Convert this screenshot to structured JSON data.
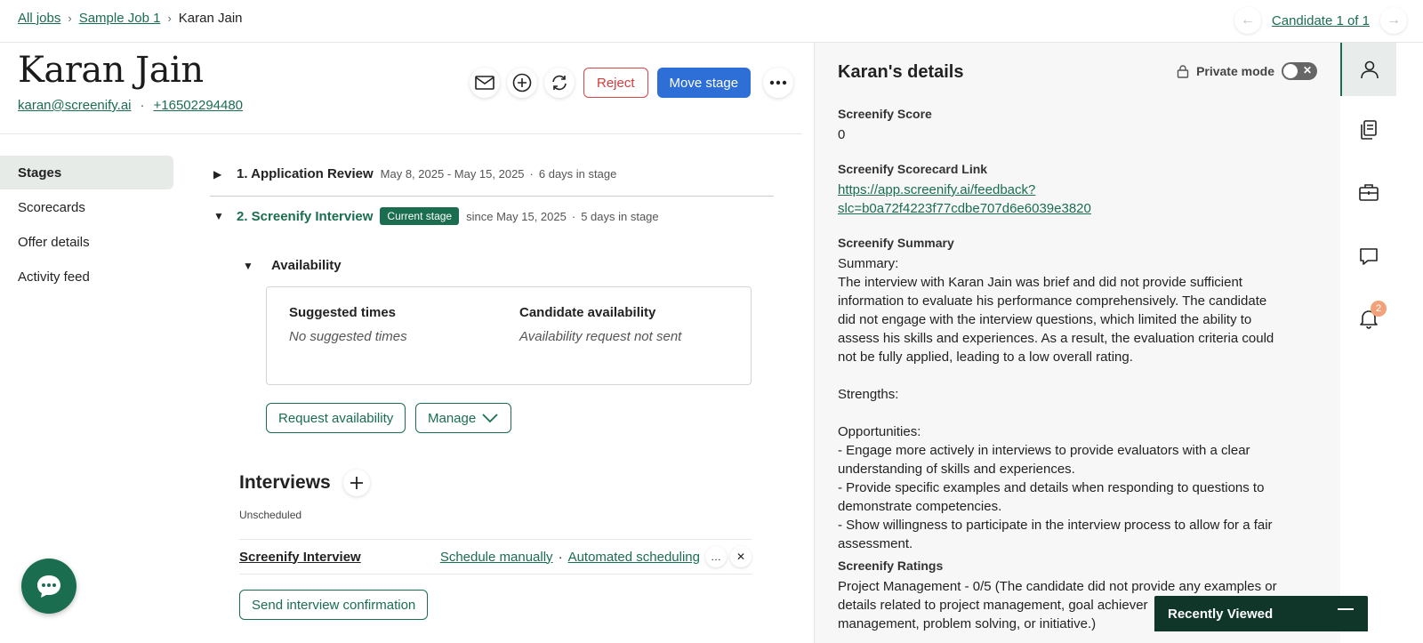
{
  "breadcrumb": {
    "all_jobs": "All jobs",
    "job": "Sample Job 1",
    "current": "Karan Jain"
  },
  "candidate_nav": {
    "label": "Candidate 1 of 1"
  },
  "candidate": {
    "name": "Karan Jain",
    "email": "karan@screenify.ai",
    "phone": "+16502294480"
  },
  "actions": {
    "reject": "Reject",
    "move_stage": "Move stage"
  },
  "nav": {
    "items": [
      "Stages",
      "Scorecards",
      "Offer details",
      "Activity feed"
    ],
    "active": "Stages"
  },
  "stages": [
    {
      "title": "1. Application Review",
      "dates": "May 8, 2025 - May 15, 2025",
      "days": "6 days in stage"
    },
    {
      "title": "2. Screenify Interview",
      "badge": "Current stage",
      "dates": "since May 15, 2025",
      "days": "5 days in stage"
    }
  ],
  "availability": {
    "title": "Availability",
    "suggested_label": "Suggested times",
    "suggested_value": "No suggested times",
    "candidate_label": "Candidate availability",
    "candidate_value": "Availability request not sent",
    "request_btn": "Request availability",
    "manage_btn": "Manage"
  },
  "interviews": {
    "title": "Interviews",
    "unscheduled": "Unscheduled",
    "row_name": "Screenify Interview",
    "schedule_manually": "Schedule manually",
    "automated": "Automated scheduling",
    "send_confirmation": "Send interview confirmation"
  },
  "details": {
    "title": "Karan's details",
    "private_mode": "Private mode",
    "score_label": "Screenify Score",
    "score_value": "0",
    "scorecard_label": "Screenify Scorecard Link",
    "scorecard_link_line1": "https://app.screenify.ai/feedback?",
    "scorecard_link_line2": "slc=b0a72f4223f77cdbe707d6e6039e3820",
    "summary_label": "Screenify Summary",
    "summary_text": "Summary:\nThe interview with Karan Jain was brief and did not provide sufficient\ninformation to evaluate his performance comprehensively. The candidate\ndid not engage with the interview questions, which limited the ability to\nassess his skills and experiences. As a result, the evaluation criteria could\nnot be fully applied, leading to a low overall rating.\n\nStrengths:\n\nOpportunities:\n- Engage more actively in interviews to provide evaluators with a clear\nunderstanding of skills and experiences.\n- Provide specific examples and details when responding to questions to\ndemonstrate competencies.\n- Show willingness to participate in the interview process to allow for a fair\nassessment.",
    "ratings_label": "Screenify Ratings",
    "ratings_text": "Project Management - 0/5 (The candidate did not provide any examples or\ndetails related to project management, goal achiever\nmanagement, problem solving, or initiative.)"
  },
  "rail": {
    "notification_count": "2"
  },
  "recently_viewed": "Recently Viewed",
  "colors": {
    "brand_green": "#1a6e4f",
    "primary_blue": "#2d6fd6",
    "reject_red": "#d23c3c",
    "dark_green": "#10362a"
  }
}
